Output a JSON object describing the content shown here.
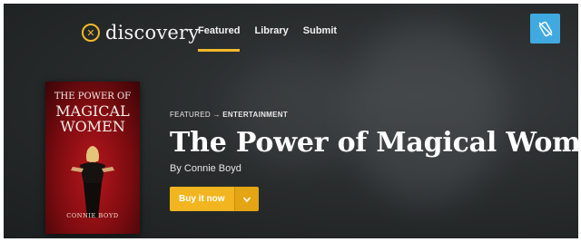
{
  "nav": {
    "logo_text": "discovery",
    "logo_icon": "compass-icon",
    "tabs": [
      {
        "label": "Featured",
        "active": true
      },
      {
        "label": "Library",
        "active": false
      },
      {
        "label": "Submit",
        "active": false
      }
    ],
    "corner_button_icon": "phone-off-icon"
  },
  "featured": {
    "breadcrumb_section": "FEATURED",
    "breadcrumb_arrow": "→",
    "breadcrumb_category": "ENTERTAINMENT",
    "title": "The Power of Magical Women",
    "byline": "By Connie Boyd",
    "buy_label": "Buy it now",
    "cover": {
      "title_line1": "THE POWER OF",
      "title_line2": "MAGICAL",
      "title_line3": "WOMEN",
      "author": "CONNIE BOYD"
    }
  },
  "colors": {
    "accent": "#f2b92a",
    "button": "#f2b51f",
    "corner_button": "#3fa9e0",
    "background": "#2a2d2e"
  }
}
